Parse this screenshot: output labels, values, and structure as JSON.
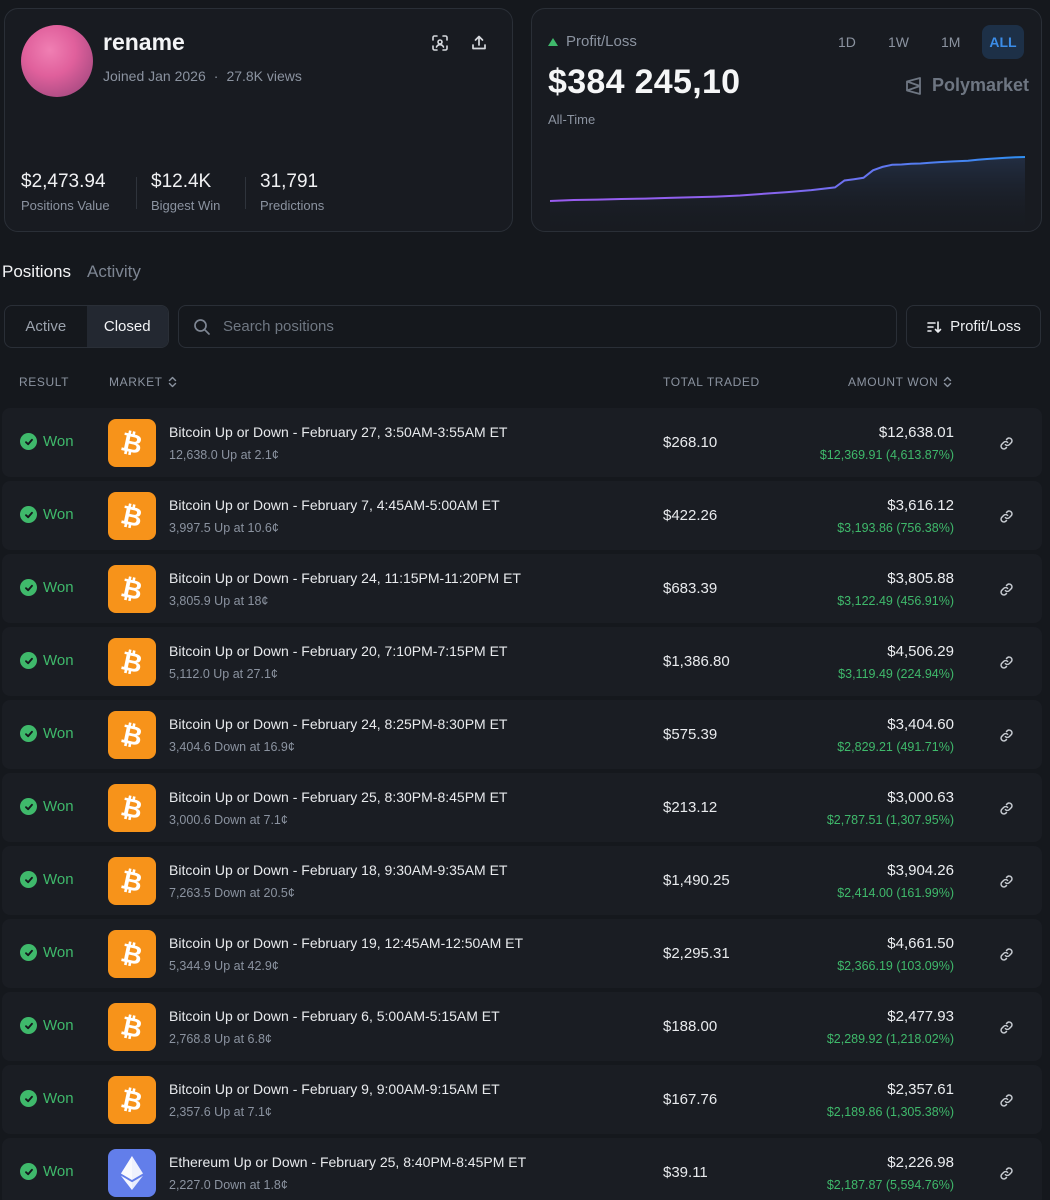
{
  "profile": {
    "username": "rename",
    "joined": "Joined Jan 2026",
    "views": "27.8K views",
    "stats": [
      {
        "value": "$2,473.94",
        "label": "Positions Value"
      },
      {
        "value": "$12.4K",
        "label": "Biggest Win"
      },
      {
        "value": "31,791",
        "label": "Predictions"
      }
    ]
  },
  "pnl": {
    "label": "Profit/Loss",
    "value": "$384 245,10",
    "period": "All-Time",
    "ranges": [
      "1D",
      "1W",
      "1M",
      "ALL"
    ],
    "active_range": "ALL",
    "brand": "Polymarket",
    "colors": {
      "line_start": "#9a5cf0",
      "line_end": "#2f8ff2",
      "positive": "#3fb96b"
    }
  },
  "chart_data": {
    "type": "area",
    "x": [
      0,
      0.05,
      0.1,
      0.15,
      0.2,
      0.25,
      0.3,
      0.35,
      0.4,
      0.45,
      0.5,
      0.55,
      0.6,
      0.62,
      0.64,
      0.66,
      0.68,
      0.7,
      0.72,
      0.74,
      0.76,
      0.78,
      0.8,
      0.82,
      0.85,
      0.88,
      0.9,
      0.92,
      0.94,
      0.96,
      0.98,
      1.0
    ],
    "values": [
      0,
      1.5,
      2.0,
      3.0,
      3.5,
      4.5,
      5.5,
      6.5,
      8.0,
      10.5,
      13.0,
      16.0,
      20.0,
      30.0,
      32.0,
      34.0,
      45.0,
      50.0,
      53.0,
      53.5,
      54.5,
      55.0,
      56.0,
      57.0,
      58.0,
      59.0,
      60.5,
      61.5,
      62.5,
      63.5,
      64.0,
      64.5
    ],
    "title": "",
    "xlabel": "",
    "ylabel": "",
    "grid": false
  },
  "tabs": [
    {
      "label": "Positions",
      "active": true
    },
    {
      "label": "Activity",
      "active": false
    }
  ],
  "filter": {
    "active": "Active",
    "closed": "Closed"
  },
  "search": {
    "placeholder": "Search positions"
  },
  "sort": {
    "label": "Profit/Loss"
  },
  "columns": {
    "result": "RESULT",
    "market": "MARKET",
    "total_traded": "TOTAL TRADED",
    "amount_won": "AMOUNT WON"
  },
  "positions": [
    {
      "result": "Won",
      "coin": "btc",
      "title": "Bitcoin Up or Down - February 27, 3:50AM-3:55AM ET",
      "detail": "12,638.0 Up at 2.1¢",
      "traded": "$268.10",
      "won": "$12,638.01",
      "profit": "$12,369.91 (4,613.87%)"
    },
    {
      "result": "Won",
      "coin": "btc",
      "title": "Bitcoin Up or Down - February 7, 4:45AM-5:00AM ET",
      "detail": "3,997.5 Up at 10.6¢",
      "traded": "$422.26",
      "won": "$3,616.12",
      "profit": "$3,193.86 (756.38%)"
    },
    {
      "result": "Won",
      "coin": "btc",
      "title": "Bitcoin Up or Down - February 24, 11:15PM-11:20PM ET",
      "detail": "3,805.9 Up at 18¢",
      "traded": "$683.39",
      "won": "$3,805.88",
      "profit": "$3,122.49 (456.91%)"
    },
    {
      "result": "Won",
      "coin": "btc",
      "title": "Bitcoin Up or Down - February 20, 7:10PM-7:15PM ET",
      "detail": "5,112.0 Up at 27.1¢",
      "traded": "$1,386.80",
      "won": "$4,506.29",
      "profit": "$3,119.49 (224.94%)"
    },
    {
      "result": "Won",
      "coin": "btc",
      "title": "Bitcoin Up or Down - February 24, 8:25PM-8:30PM ET",
      "detail": "3,404.6 Down at 16.9¢",
      "traded": "$575.39",
      "won": "$3,404.60",
      "profit": "$2,829.21 (491.71%)"
    },
    {
      "result": "Won",
      "coin": "btc",
      "title": "Bitcoin Up or Down - February 25, 8:30PM-8:45PM ET",
      "detail": "3,000.6 Down at 7.1¢",
      "traded": "$213.12",
      "won": "$3,000.63",
      "profit": "$2,787.51 (1,307.95%)"
    },
    {
      "result": "Won",
      "coin": "btc",
      "title": "Bitcoin Up or Down - February 18, 9:30AM-9:35AM ET",
      "detail": "7,263.5 Down at 20.5¢",
      "traded": "$1,490.25",
      "won": "$3,904.26",
      "profit": "$2,414.00 (161.99%)"
    },
    {
      "result": "Won",
      "coin": "btc",
      "title": "Bitcoin Up or Down - February 19, 12:45AM-12:50AM ET",
      "detail": "5,344.9 Up at 42.9¢",
      "traded": "$2,295.31",
      "won": "$4,661.50",
      "profit": "$2,366.19 (103.09%)"
    },
    {
      "result": "Won",
      "coin": "btc",
      "title": "Bitcoin Up or Down - February 6, 5:00AM-5:15AM ET",
      "detail": "2,768.8 Up at 6.8¢",
      "traded": "$188.00",
      "won": "$2,477.93",
      "profit": "$2,289.92 (1,218.02%)"
    },
    {
      "result": "Won",
      "coin": "btc",
      "title": "Bitcoin Up or Down - February 9, 9:00AM-9:15AM ET",
      "detail": "2,357.6 Up at 7.1¢",
      "traded": "$167.76",
      "won": "$2,357.61",
      "profit": "$2,189.86 (1,305.38%)"
    },
    {
      "result": "Won",
      "coin": "eth",
      "title": "Ethereum Up or Down - February 25, 8:40PM-8:45PM ET",
      "detail": "2,227.0 Down at 1.8¢",
      "traded": "$39.11",
      "won": "$2,226.98",
      "profit": "$2,187.87 (5,594.76%)"
    }
  ]
}
